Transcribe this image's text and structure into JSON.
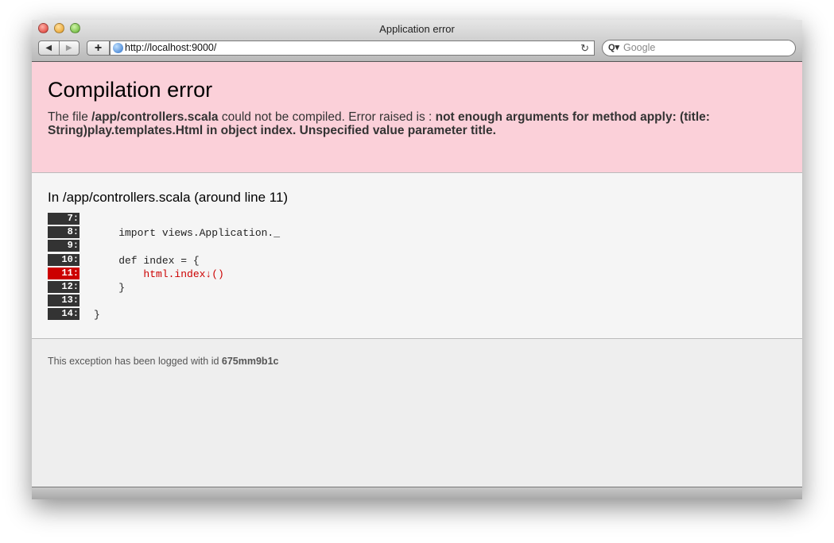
{
  "window": {
    "title": "Application error"
  },
  "toolbar": {
    "back": "◀",
    "forward": "▶",
    "add": "+",
    "url": "http://localhost:9000/",
    "reload": "↻",
    "search_placeholder": "Google",
    "search_icon": "Q▾"
  },
  "error": {
    "heading": "Compilation error",
    "pre": "The file ",
    "file": "/app/controllers.scala",
    "mid": " could not be compiled. Error raised is : ",
    "message": "not enough arguments for method apply: (title: String)play.templates.Html in object index. Unspecified value parameter title."
  },
  "source": {
    "heading": "In /app/controllers.scala (around line 11)",
    "lines": [
      {
        "num": "7:",
        "code": ""
      },
      {
        "num": "8:",
        "code": "    import views.Application._"
      },
      {
        "num": "9:",
        "code": ""
      },
      {
        "num": "10:",
        "code": "    def index = {"
      },
      {
        "num": "11:",
        "code": "        html.index↓()"
      },
      {
        "num": "12:",
        "code": "    }"
      },
      {
        "num": "13:",
        "code": ""
      },
      {
        "num": "14:",
        "code": "}"
      }
    ],
    "highlight_line": "11:"
  },
  "footer": {
    "text": "This exception has been logged with id ",
    "id": "675mm9b1c"
  }
}
